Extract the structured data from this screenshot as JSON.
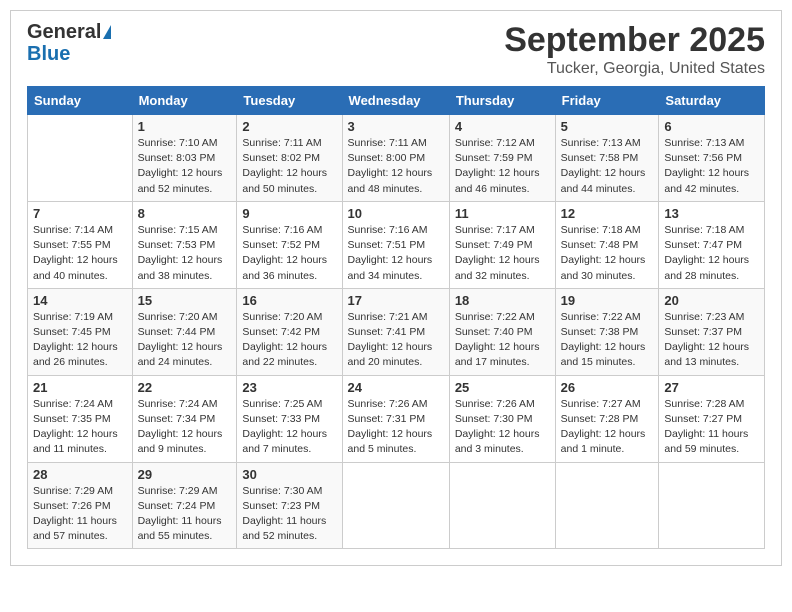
{
  "header": {
    "logo_general": "General",
    "logo_blue": "Blue",
    "month_title": "September 2025",
    "location": "Tucker, Georgia, United States"
  },
  "columns": [
    "Sunday",
    "Monday",
    "Tuesday",
    "Wednesday",
    "Thursday",
    "Friday",
    "Saturday"
  ],
  "weeks": [
    [
      {
        "day": "",
        "info": ""
      },
      {
        "day": "1",
        "info": "Sunrise: 7:10 AM\nSunset: 8:03 PM\nDaylight: 12 hours\nand 52 minutes."
      },
      {
        "day": "2",
        "info": "Sunrise: 7:11 AM\nSunset: 8:02 PM\nDaylight: 12 hours\nand 50 minutes."
      },
      {
        "day": "3",
        "info": "Sunrise: 7:11 AM\nSunset: 8:00 PM\nDaylight: 12 hours\nand 48 minutes."
      },
      {
        "day": "4",
        "info": "Sunrise: 7:12 AM\nSunset: 7:59 PM\nDaylight: 12 hours\nand 46 minutes."
      },
      {
        "day": "5",
        "info": "Sunrise: 7:13 AM\nSunset: 7:58 PM\nDaylight: 12 hours\nand 44 minutes."
      },
      {
        "day": "6",
        "info": "Sunrise: 7:13 AM\nSunset: 7:56 PM\nDaylight: 12 hours\nand 42 minutes."
      }
    ],
    [
      {
        "day": "7",
        "info": "Sunrise: 7:14 AM\nSunset: 7:55 PM\nDaylight: 12 hours\nand 40 minutes."
      },
      {
        "day": "8",
        "info": "Sunrise: 7:15 AM\nSunset: 7:53 PM\nDaylight: 12 hours\nand 38 minutes."
      },
      {
        "day": "9",
        "info": "Sunrise: 7:16 AM\nSunset: 7:52 PM\nDaylight: 12 hours\nand 36 minutes."
      },
      {
        "day": "10",
        "info": "Sunrise: 7:16 AM\nSunset: 7:51 PM\nDaylight: 12 hours\nand 34 minutes."
      },
      {
        "day": "11",
        "info": "Sunrise: 7:17 AM\nSunset: 7:49 PM\nDaylight: 12 hours\nand 32 minutes."
      },
      {
        "day": "12",
        "info": "Sunrise: 7:18 AM\nSunset: 7:48 PM\nDaylight: 12 hours\nand 30 minutes."
      },
      {
        "day": "13",
        "info": "Sunrise: 7:18 AM\nSunset: 7:47 PM\nDaylight: 12 hours\nand 28 minutes."
      }
    ],
    [
      {
        "day": "14",
        "info": "Sunrise: 7:19 AM\nSunset: 7:45 PM\nDaylight: 12 hours\nand 26 minutes."
      },
      {
        "day": "15",
        "info": "Sunrise: 7:20 AM\nSunset: 7:44 PM\nDaylight: 12 hours\nand 24 minutes."
      },
      {
        "day": "16",
        "info": "Sunrise: 7:20 AM\nSunset: 7:42 PM\nDaylight: 12 hours\nand 22 minutes."
      },
      {
        "day": "17",
        "info": "Sunrise: 7:21 AM\nSunset: 7:41 PM\nDaylight: 12 hours\nand 20 minutes."
      },
      {
        "day": "18",
        "info": "Sunrise: 7:22 AM\nSunset: 7:40 PM\nDaylight: 12 hours\nand 17 minutes."
      },
      {
        "day": "19",
        "info": "Sunrise: 7:22 AM\nSunset: 7:38 PM\nDaylight: 12 hours\nand 15 minutes."
      },
      {
        "day": "20",
        "info": "Sunrise: 7:23 AM\nSunset: 7:37 PM\nDaylight: 12 hours\nand 13 minutes."
      }
    ],
    [
      {
        "day": "21",
        "info": "Sunrise: 7:24 AM\nSunset: 7:35 PM\nDaylight: 12 hours\nand 11 minutes."
      },
      {
        "day": "22",
        "info": "Sunrise: 7:24 AM\nSunset: 7:34 PM\nDaylight: 12 hours\nand 9 minutes."
      },
      {
        "day": "23",
        "info": "Sunrise: 7:25 AM\nSunset: 7:33 PM\nDaylight: 12 hours\nand 7 minutes."
      },
      {
        "day": "24",
        "info": "Sunrise: 7:26 AM\nSunset: 7:31 PM\nDaylight: 12 hours\nand 5 minutes."
      },
      {
        "day": "25",
        "info": "Sunrise: 7:26 AM\nSunset: 7:30 PM\nDaylight: 12 hours\nand 3 minutes."
      },
      {
        "day": "26",
        "info": "Sunrise: 7:27 AM\nSunset: 7:28 PM\nDaylight: 12 hours\nand 1 minute."
      },
      {
        "day": "27",
        "info": "Sunrise: 7:28 AM\nSunset: 7:27 PM\nDaylight: 11 hours\nand 59 minutes."
      }
    ],
    [
      {
        "day": "28",
        "info": "Sunrise: 7:29 AM\nSunset: 7:26 PM\nDaylight: 11 hours\nand 57 minutes."
      },
      {
        "day": "29",
        "info": "Sunrise: 7:29 AM\nSunset: 7:24 PM\nDaylight: 11 hours\nand 55 minutes."
      },
      {
        "day": "30",
        "info": "Sunrise: 7:30 AM\nSunset: 7:23 PM\nDaylight: 11 hours\nand 52 minutes."
      },
      {
        "day": "",
        "info": ""
      },
      {
        "day": "",
        "info": ""
      },
      {
        "day": "",
        "info": ""
      },
      {
        "day": "",
        "info": ""
      }
    ]
  ]
}
